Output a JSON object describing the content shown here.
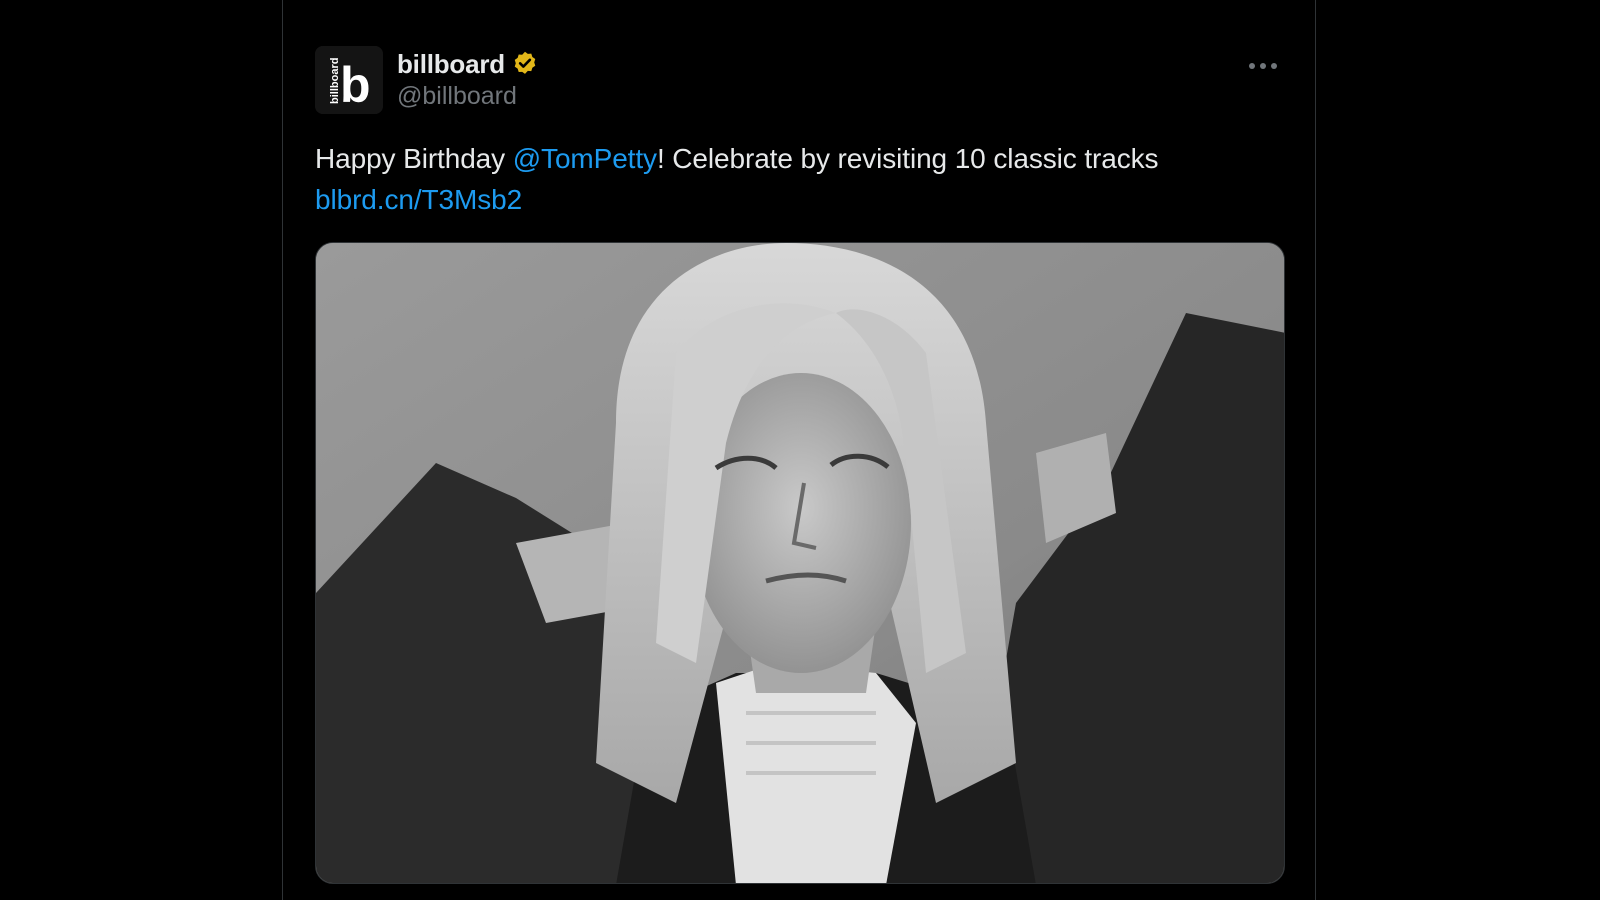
{
  "tweet": {
    "display_name": "billboard",
    "handle": "@billboard",
    "avatar_icon": "billboard-logo-icon",
    "verified_icon": "verified-badge-icon",
    "more_icon": "more-options-icon",
    "text_prefix": "Happy Birthday ",
    "mention": "@TomPetty",
    "text_suffix": "! Celebrate by revisiting 10 classic tracks",
    "link": "blbrd.cn/T3Msb2",
    "logo_wordmark": "billboard",
    "logo_letter": "b",
    "media": {
      "description_icon": "photo-icon"
    }
  },
  "colors": {
    "background": "#000000",
    "text": "#e7e9ea",
    "secondary_text": "#71767b",
    "link": "#1d9bf0",
    "verified": "#e2b719",
    "border": "#2f3336"
  }
}
